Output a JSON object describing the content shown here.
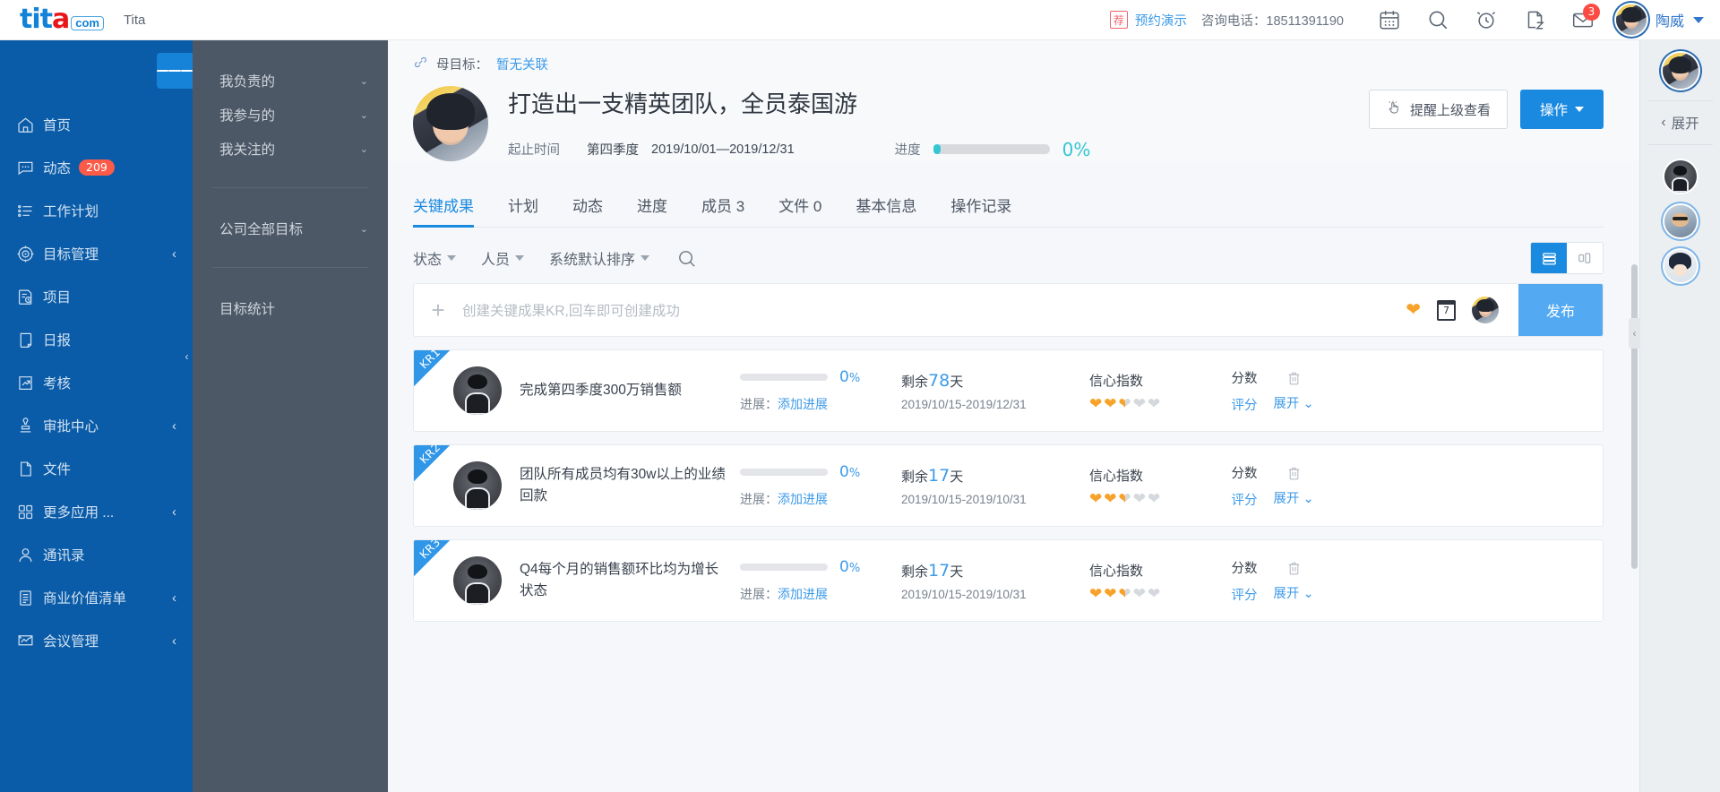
{
  "topbar": {
    "logo_ti": "tit",
    "logo_a": "a",
    "logo_com": "com",
    "brand_name": "Tita",
    "promo_badge": "荐",
    "promo_link": "预约演示",
    "promo_phone": "咨询电话：18511391190",
    "mail_badge": "3",
    "user_name": "陶威"
  },
  "sidebar": {
    "items": [
      {
        "label": "首页",
        "icon": "home-icon",
        "badge": "",
        "arrow": false
      },
      {
        "label": "动态",
        "icon": "message-icon",
        "badge": "209",
        "arrow": false
      },
      {
        "label": "工作计划",
        "icon": "list-icon",
        "badge": "",
        "arrow": false
      },
      {
        "label": "目标管理",
        "icon": "target-icon",
        "badge": "",
        "arrow": true
      },
      {
        "label": "项目",
        "icon": "project-icon",
        "badge": "",
        "arrow": false
      },
      {
        "label": "日报",
        "icon": "report-icon",
        "badge": "",
        "arrow": false
      },
      {
        "label": "考核",
        "icon": "assessment-icon",
        "badge": "",
        "arrow": false
      },
      {
        "label": "审批中心",
        "icon": "approval-icon",
        "badge": "",
        "arrow": true
      },
      {
        "label": "文件",
        "icon": "file-icon",
        "badge": "",
        "arrow": false
      },
      {
        "label": "更多应用 ...",
        "icon": "apps-icon",
        "badge": "",
        "arrow": true
      },
      {
        "label": "通讯录",
        "icon": "contacts-icon",
        "badge": "",
        "arrow": false
      },
      {
        "label": "商业价值清单",
        "icon": "value-list-icon",
        "badge": "",
        "arrow": true
      },
      {
        "label": "会议管理",
        "icon": "meeting-icon",
        "badge": "",
        "arrow": true
      }
    ]
  },
  "subnav": {
    "group1": [
      {
        "label": "我负责的",
        "arrow": "⌄"
      },
      {
        "label": "我参与的",
        "arrow": "⌄"
      },
      {
        "label": "我关注的",
        "arrow": "⌄"
      }
    ],
    "group2": [
      {
        "label": "公司全部目标",
        "arrow": "⌄"
      }
    ],
    "group3": [
      {
        "label": "目标统计",
        "arrow": ""
      }
    ],
    "collapse": "‹"
  },
  "goal": {
    "parent_label": "母目标：",
    "parent_value": "暂无关联",
    "title": "打造出一支精英团队，全员泰国游",
    "time_label": "起止时间",
    "quarter": "第四季度",
    "dates": "2019/10/01—2019/12/31",
    "progress_label": "进度",
    "progress_pct": "0%",
    "progress_value": 0,
    "btn_remind": "提醒上级查看",
    "btn_action": "操作"
  },
  "tabs": [
    {
      "label": "关键成果",
      "active": true
    },
    {
      "label": "计划",
      "active": false
    },
    {
      "label": "动态",
      "active": false
    },
    {
      "label": "进度",
      "active": false
    },
    {
      "label": "成员 3",
      "active": false
    },
    {
      "label": "文件 0",
      "active": false
    },
    {
      "label": "基本信息",
      "active": false
    },
    {
      "label": "操作记录",
      "active": false
    }
  ],
  "filters": [
    {
      "label": "状态"
    },
    {
      "label": "人员"
    },
    {
      "label": "系统默认排序"
    }
  ],
  "create_row": {
    "placeholder": "创建关键成果KR,回车即可创建成功",
    "publish": "发布"
  },
  "kr_list": [
    {
      "ribbon": "KR1",
      "title": "完成第四季度300万销售额",
      "percent": "0",
      "percent_sign": "%",
      "progress_label": "进展：",
      "progress_action": "添加进展",
      "remain_prefix": "剩余",
      "remain_days": "78",
      "remain_suffix": "天",
      "date_range": "2019/10/15-2019/12/31",
      "confidence_label": "信心指数",
      "confidence_value": 2.5,
      "score_label": "分数",
      "score_action": "评分",
      "expand_label": "展开"
    },
    {
      "ribbon": "KR2",
      "title": "团队所有成员均有30w以上的业绩回款",
      "percent": "0",
      "percent_sign": "%",
      "progress_label": "进展：",
      "progress_action": "添加进展",
      "remain_prefix": "剩余",
      "remain_days": "17",
      "remain_suffix": "天",
      "date_range": "2019/10/15-2019/10/31",
      "confidence_label": "信心指数",
      "confidence_value": 2.5,
      "score_label": "分数",
      "score_action": "评分",
      "expand_label": "展开"
    },
    {
      "ribbon": "KR3",
      "title": "Q4每个月的销售额环比均为增长状态",
      "percent": "0",
      "percent_sign": "%",
      "progress_label": "进展：",
      "progress_action": "添加进展",
      "remain_prefix": "剩余",
      "remain_days": "17",
      "remain_suffix": "天",
      "date_range": "2019/10/15-2019/10/31",
      "confidence_label": "信心指数",
      "confidence_value": 2.5,
      "score_label": "分数",
      "score_action": "评分",
      "expand_label": "展开"
    }
  ],
  "rightrail": {
    "expand_label": "展开",
    "expand_caret": "‹",
    "collapse": "‹"
  },
  "colors": {
    "brand_blue": "#0b5ca8",
    "accent_blue": "#1a8ae0",
    "link_blue": "#3d9ae8",
    "teal": "#35c6d4",
    "orange": "#f7a32b",
    "red_badge": "#fc5b4a",
    "subnav_bg": "#4c5866"
  }
}
